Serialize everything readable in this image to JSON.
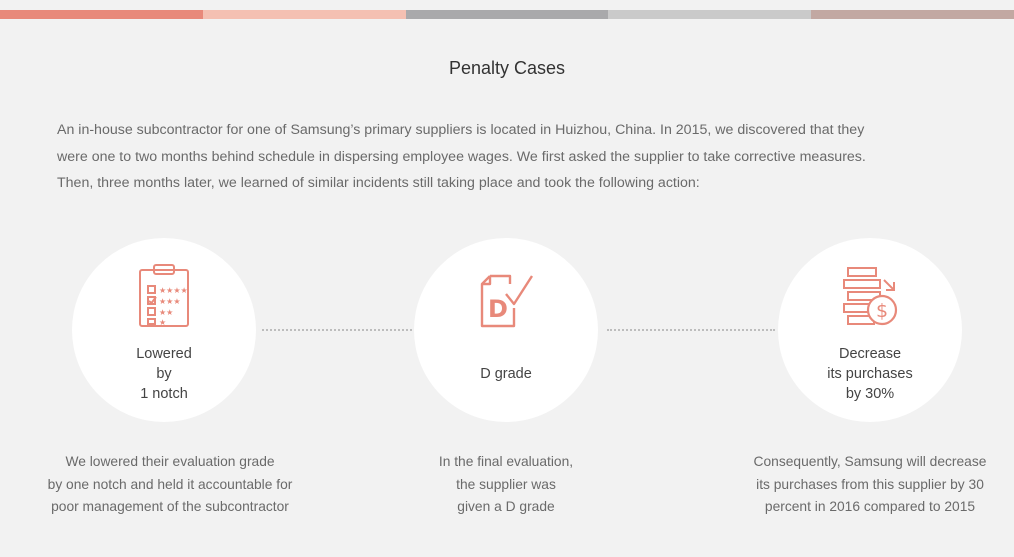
{
  "colors": {
    "accent": "#e8897a",
    "bar": [
      "#e8897a",
      "#f4c0b2",
      "#a9a9ab",
      "#cacaca",
      "#c2a8a2"
    ],
    "background": "#f2f2f2"
  },
  "title": "Penalty Cases",
  "intro": [
    "An in-house subcontractor for one of Samsung’s primary suppliers is located in Huizhou, China. In 2015, we discovered that they",
    "were one to two months behind schedule in dispersing employee wages. We first asked the supplier to take corrective measures.",
    "Then, three months later, we learned of similar incidents still taking place and took the following action:"
  ],
  "steps": [
    {
      "icon": "checklist-icon",
      "label_lines": [
        "Lowered",
        "by",
        "1 notch"
      ],
      "desc_lines": [
        "We lowered their evaluation grade",
        "by one notch and held it accountable for",
        "poor management of the subcontractor"
      ]
    },
    {
      "icon": "d-grade-document-icon",
      "icon_text": "D",
      "label_lines": [
        "D grade"
      ],
      "desc_lines": [
        "In the final evaluation,",
        "the supplier was",
        "given a D grade"
      ]
    },
    {
      "icon": "decreasing-purchases-icon",
      "label_lines": [
        "Decrease",
        "its purchases",
        "by 30%"
      ],
      "desc_lines": [
        "Consequently, Samsung will decrease",
        "its purchases from this supplier by 30",
        "percent in 2016 compared to 2015"
      ]
    }
  ]
}
